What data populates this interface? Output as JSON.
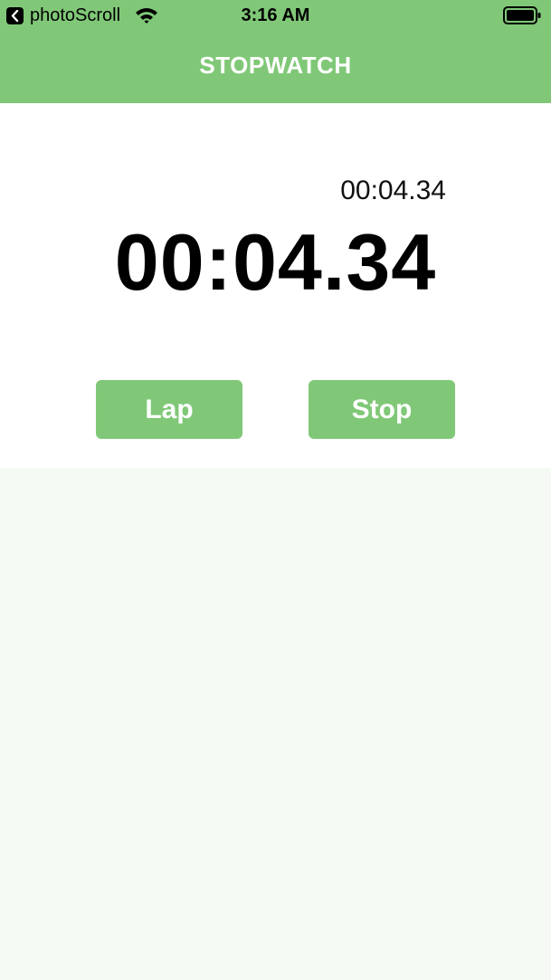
{
  "status_bar": {
    "back_app": "photoScroll",
    "time": "3:16 AM",
    "icons": [
      "back-chevron-icon",
      "wifi-icon",
      "battery-icon"
    ]
  },
  "nav": {
    "title": "STOPWATCH"
  },
  "timer": {
    "lap_time": "00:04.34",
    "total_time": "00:04.34"
  },
  "buttons": {
    "lap_label": "Lap",
    "stop_label": "Stop"
  },
  "laps": [],
  "colors": {
    "accent": "#80c878",
    "panel": "#ffffff",
    "background": "#f6faf5"
  }
}
